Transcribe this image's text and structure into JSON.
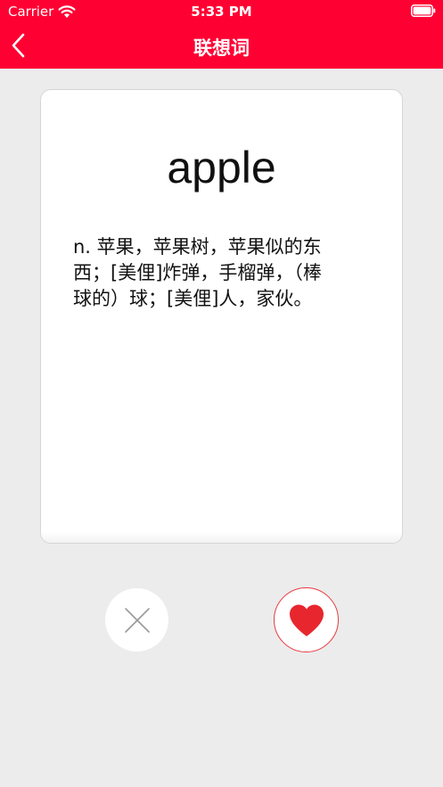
{
  "status_bar": {
    "carrier": "Carrier",
    "time": "5:33 PM"
  },
  "nav": {
    "title": "联想词",
    "back_icon": "chevron-left-icon"
  },
  "card": {
    "word": "apple",
    "definition_lines": [
      "n. 苹果，苹果树，苹果似的东",
      "西；[美俚]炸弹，手榴弹，（棒",
      "球的）球；[美俚]人，家伙。"
    ]
  },
  "actions": {
    "dislike_icon": "close-icon",
    "like_icon": "heart-icon"
  },
  "colors": {
    "accent": "#ff0033",
    "heart": "#e8262e",
    "background": "#ececec"
  }
}
